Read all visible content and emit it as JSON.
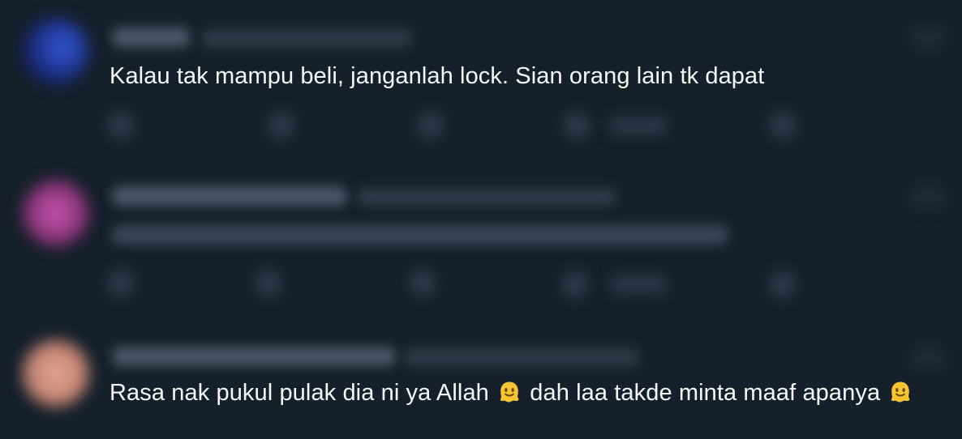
{
  "tweets": [
    {
      "text": "Kalau tak mampu beli, janganlah lock. Sian orang lain tk dapat",
      "avatar_color": "#1f3fa0"
    },
    {
      "text": "",
      "avatar_color": "#b0449a"
    },
    {
      "text_before_emoji": "Rasa nak pukul pulak dia ni ya Allah",
      "text_after_emoji": "dah laa takde minta maaf apanya",
      "emoji": "melting-face",
      "avatar_color": "#d99a86"
    }
  ],
  "colors": {
    "background": "#15202b",
    "text": "#f7f9f9",
    "emoji_fill": "#f5c431"
  }
}
